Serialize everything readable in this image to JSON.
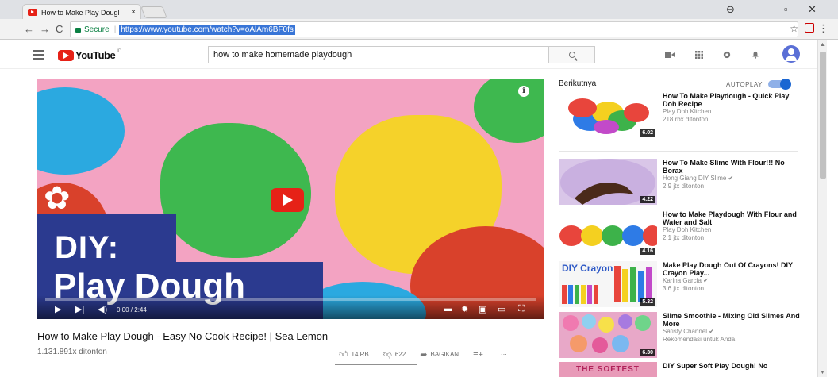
{
  "browser": {
    "tab_title": "How to Make Play Dougl",
    "tab_close": "×",
    "secure_label": "Secure",
    "url": "https://www.youtube.com/watch?v=oAlAm6BF0fs",
    "nav_back": "←",
    "nav_forward": "→",
    "nav_reload": "C",
    "star": "☆",
    "menu": "⋮",
    "win_account": "⊖",
    "win_min": "–",
    "win_max": "▫",
    "win_close": "✕"
  },
  "youtube": {
    "logo_text": "YouTube",
    "logo_region": "ID",
    "search_value": "how to make homemade playdough"
  },
  "player": {
    "overlay_line1": "DIY:",
    "overlay_line2": "Play Dough",
    "time": "0:00 / 2:44",
    "progress": 0,
    "info": "i"
  },
  "video": {
    "title": "How to Make Play Dough - Easy No Cook Recipe! | Sea Lemon",
    "views": "1.131.891x ditonton",
    "likes": "14 RB",
    "dislikes": "622",
    "share": "BAGIKAN",
    "more": "···"
  },
  "sidebar": {
    "heading": "Berikutnya",
    "autoplay": "AUTOPLAY",
    "items": [
      {
        "title": "How To Make Playdough - Quick Play Doh Recipe",
        "channel": "Play Doh Kitchen",
        "views": "218 rbx ditonton",
        "duration": "6.02"
      },
      {
        "title": "How To Make Slime With Flour!!! No Borax",
        "channel": "Hong Giang DIY Slime ✔",
        "views": "2,9 jtx ditonton",
        "duration": "4.22"
      },
      {
        "title": "How to Make Playdough With Flour and Water and Salt",
        "channel": "Play Doh Kitchen",
        "views": "2,1 jtx ditonton",
        "duration": "4.16"
      },
      {
        "title": "Make Play Dough Out Of Crayons! DIY Crayon Play...",
        "channel": "Karina Garcia ✔",
        "views": "3,6 jtx ditonton",
        "duration": "5.32",
        "thumb_text": "DIY Crayon"
      },
      {
        "title": "Slime Smoothie - Mixing Old Slimes And More",
        "channel": "Satisfy Channel ✔",
        "views": "Rekomendasi untuk Anda",
        "duration": "6.30"
      },
      {
        "title": "DIY Super Soft Play Dough! No",
        "thumb_text": "THE SOFTEST"
      }
    ]
  }
}
